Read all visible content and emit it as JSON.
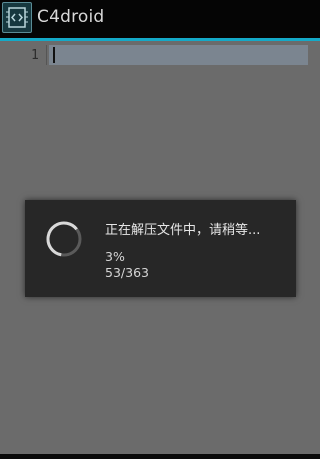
{
  "app": {
    "title": "C4droid",
    "icon": "c4droid-app-icon"
  },
  "editor": {
    "line_number": "1",
    "content": ""
  },
  "dialog": {
    "message": "正在解压文件中，请稍等...",
    "percent": "3%",
    "count": "53/363",
    "progress_fraction": 0.03,
    "icon": "spinner-icon"
  },
  "colors": {
    "accent": "#14aac8",
    "dialog_background": "#272727",
    "dim_background": "#6b6b6b"
  }
}
